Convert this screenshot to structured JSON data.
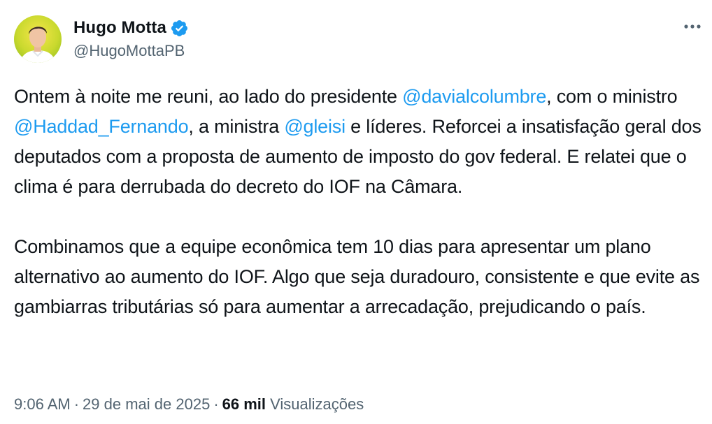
{
  "author": {
    "display_name": "Hugo Motta",
    "handle": "@HugoMottaPB",
    "verified_color": "#1d9bf0"
  },
  "tweet": {
    "paragraph1": {
      "t1": "Ontem à noite me reuni, ao lado do presidente ",
      "m1": "@davialcolumbre",
      "t2": ", com o ministro ",
      "m2": "@Haddad_Fernando",
      "t3": ", a ministra ",
      "m3": "@gleisi",
      "t4": " e líderes. Reforcei a insatisfação geral dos deputados com a proposta de aumento de imposto do gov federal. E relatei que o clima é para derrubada do decreto do IOF na Câmara."
    },
    "paragraph2": "Combinamos que a equipe econômica tem 10 dias para apresentar um plano alternativo ao aumento do IOF. Algo que seja duradouro, consistente e que evite as gambiarras tributárias só para aumentar a arrecadação, prejudicando o país."
  },
  "meta": {
    "time": "9:06 AM",
    "separator": "·",
    "date": "29 de mai de 2025",
    "views_count": "66 mil",
    "views_label": "Visualizações"
  },
  "icons": {
    "more": "more-horizontal-icon",
    "verified": "verified-badge-icon"
  },
  "colors": {
    "mention": "#1d9bf0",
    "secondary_text": "#536471",
    "primary_text": "#0f1419"
  }
}
